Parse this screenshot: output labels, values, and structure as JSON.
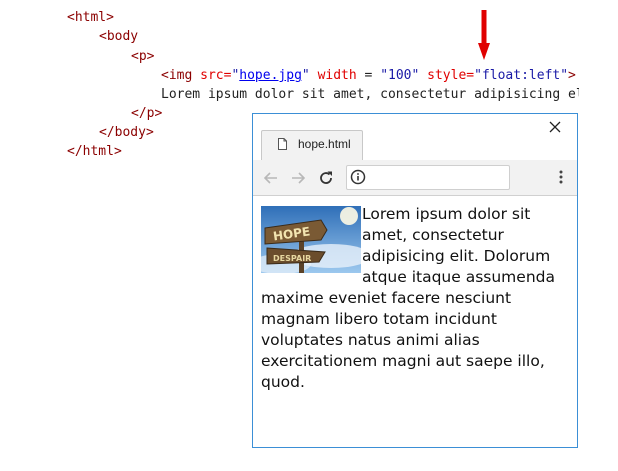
{
  "code": {
    "line1": "<html>",
    "line2": "<body",
    "line3": "<p>",
    "img_open": "<img",
    "src_attr": "src=",
    "src_q1": "\"",
    "src_value": "hope.jpg",
    "src_q2": "\"",
    "width_attr": "width",
    "eq1": " = ",
    "width_value": "\"100\"",
    "style_attr": "style=",
    "style_value": "\"float:left\"",
    "img_close": ">",
    "text_line": "Lorem ipsum dolor sit amet, consectetur adipisicing eli",
    "line6": "</p>",
    "line7": "</body>",
    "line8": "</html>"
  },
  "browser": {
    "tab_title": "hope.html",
    "paragraph": "Lorem ipsum dolor sit amet, consectetur adipisicing elit. Dolorum atque itaque assumenda maxime eveniet facere nesciunt magnam libero totam incidunt voluptates natus animi alias exercitationem magni aut saepe illo, quod."
  },
  "colors": {
    "arrow": "#e00000",
    "window_border": "#3b8fd6"
  }
}
